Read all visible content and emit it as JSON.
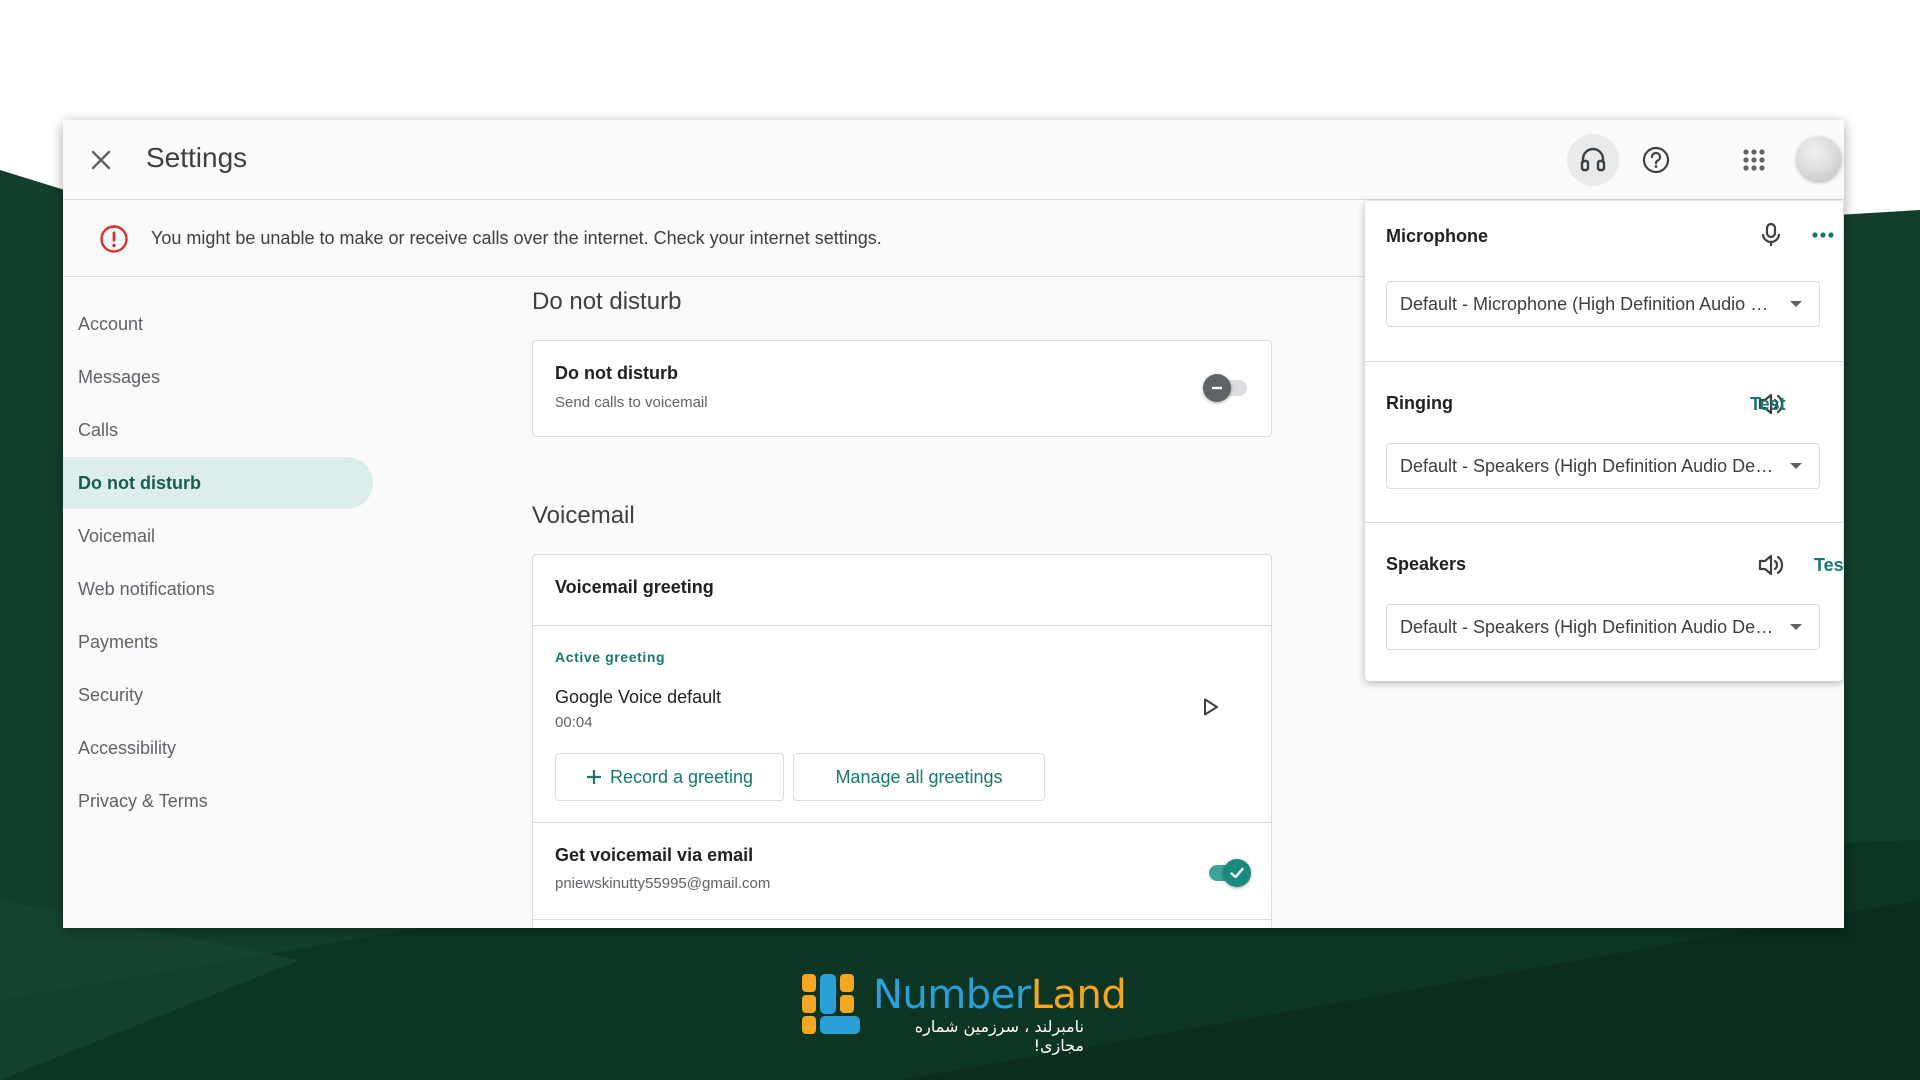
{
  "header": {
    "title": "Settings"
  },
  "banner": {
    "message": "You might be unable to make or receive calls over the internet. Check your internet settings."
  },
  "sidebar": {
    "items": [
      {
        "label": "Account"
      },
      {
        "label": "Messages"
      },
      {
        "label": "Calls"
      },
      {
        "label": "Do not disturb",
        "selected": true
      },
      {
        "label": "Voicemail"
      },
      {
        "label": "Web notifications"
      },
      {
        "label": "Payments"
      },
      {
        "label": "Security"
      },
      {
        "label": "Accessibility"
      },
      {
        "label": "Privacy & Terms"
      }
    ]
  },
  "dnd": {
    "section_title": "Do not disturb",
    "title": "Do not disturb",
    "subtitle": "Send calls to voicemail",
    "enabled": false
  },
  "voicemail": {
    "section_title": "Voicemail",
    "greeting_title": "Voicemail greeting",
    "active_label": "Active greeting",
    "greeting_name": "Google Voice default",
    "greeting_duration": "00:04",
    "record_label": "Record a greeting",
    "manage_label": "Manage all greetings",
    "email_title": "Get voicemail via email",
    "email_address": "pniewskinutty55995@gmail.com",
    "email_enabled": true
  },
  "audio": {
    "microphone": {
      "label": "Microphone",
      "value": "Default - Microphone (High Definition Audio Device)"
    },
    "ringing": {
      "label": "Ringing",
      "test_label": "Test",
      "value": "Default - Speakers (High Definition Audio Device)"
    },
    "speakers": {
      "label": "Speakers",
      "test_label": "Test",
      "value": "Default - Speakers (High Definition Audio Device)"
    }
  },
  "icons": {
    "close": "close-icon",
    "headset": "headset-icon",
    "help": "help-icon",
    "apps": "apps-grid-icon",
    "warning": "error-icon",
    "mic": "microphone-icon",
    "more": "more-horiz-icon",
    "volume": "volume-icon",
    "play": "play-icon",
    "add": "plus-icon",
    "check": "check-icon"
  },
  "colors": {
    "accent": "#17786c",
    "selected_bg": "#dbeeec",
    "warning": "#d93025",
    "background_dark": "#0f3d2a"
  },
  "logo": {
    "name_part1": "Number",
    "name_part2": "Land",
    "tagline": "نامبرلند ، سرزمین شماره مجازی!"
  }
}
